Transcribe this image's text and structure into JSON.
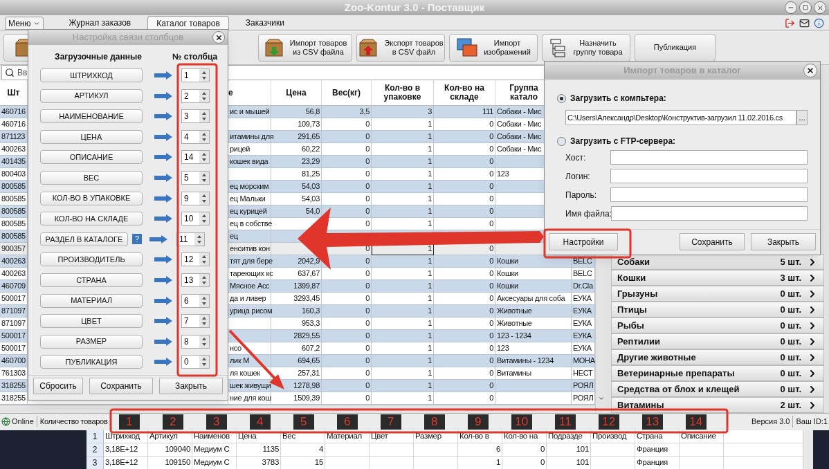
{
  "window": {
    "title": "Zoo-Kontur 3.0 - Поставщик"
  },
  "menu_button": "Меню",
  "tabs": [
    {
      "label": "Журнал заказов",
      "selected": false
    },
    {
      "label": "Каталог товаров",
      "selected": true
    },
    {
      "label": "Заказчики",
      "selected": false
    }
  ],
  "toolbar": [
    {
      "kind": "box"
    },
    {
      "kind": "import",
      "lines": [
        "Импорт товаров",
        "из CSV файла"
      ]
    },
    {
      "kind": "export",
      "lines": [
        "Экспорт товаров",
        "в CSV файл"
      ]
    },
    {
      "kind": "images",
      "lines": [
        "Импорт",
        "изображений"
      ]
    },
    {
      "kind": "group",
      "lines": [
        "Назначить",
        "группу товара"
      ]
    },
    {
      "kind": "plain",
      "lines": [
        "Публикация"
      ]
    }
  ],
  "search": {
    "placeholder": "Вв"
  },
  "table": {
    "columns": [
      "Шт",
      "е",
      "Цена",
      "Вес(кг)",
      "Кол-во в упаковке",
      "Кол-во на складе",
      "Группа катало"
    ],
    "rows": [
      {
        "selected": false,
        "cells": [
          "460716",
          "ис и мышей",
          "56,8",
          "3,5",
          "3",
          "111",
          "Собаки - Мис",
          null
        ]
      },
      {
        "selected": false,
        "cells": [
          "460716",
          null,
          "109,73",
          "0",
          "1",
          "0",
          "Собаки - Мис",
          null
        ]
      },
      {
        "selected": false,
        "cells": [
          "871123",
          "итамины для",
          "291,65",
          "0",
          "1",
          "0",
          "Собаки - Мис",
          null
        ]
      },
      {
        "selected": false,
        "cells": [
          "400263",
          "рицей",
          "60,22",
          "0",
          "1",
          "0",
          "Собаки - Мис",
          null
        ]
      },
      {
        "selected": false,
        "cells": [
          "401435",
          "кошек вида",
          "23,29",
          "0",
          "1",
          "0",
          null,
          null
        ]
      },
      {
        "selected": false,
        "cells": [
          "800403",
          null,
          "81,25",
          "0",
          "1",
          "0",
          "123",
          null
        ]
      },
      {
        "selected": false,
        "cells": [
          "800585",
          "ец морским",
          "54,03",
          "0",
          "1",
          "0",
          null,
          null
        ]
      },
      {
        "selected": false,
        "cells": [
          "800585",
          "ец Мальки",
          "54,03",
          "0",
          "1",
          "0",
          null,
          null
        ]
      },
      {
        "selected": false,
        "cells": [
          "800585",
          "ец курицей",
          "54,0",
          "0",
          "1",
          "0",
          null,
          null
        ]
      },
      {
        "selected": false,
        "cells": [
          "800585",
          "ец в собстве",
          null,
          "0",
          "1",
          "0",
          null,
          null
        ]
      },
      {
        "selected": false,
        "cells": [
          "800585",
          "ец",
          null,
          null,
          null,
          null,
          null,
          null
        ]
      },
      {
        "selected": true,
        "cells": [
          "900357",
          "енситив кон",
          null,
          "0",
          "1",
          "0",
          null,
          null
        ]
      },
      {
        "selected": false,
        "cells": [
          "400263",
          "тят для бере",
          "2042,9",
          "0",
          "1",
          "0",
          "Кошки",
          "BELC"
        ]
      },
      {
        "selected": false,
        "cells": [
          "400263",
          "тареющих кс",
          "637,67",
          "0",
          "1",
          "0",
          "Кошки",
          "BELC"
        ]
      },
      {
        "selected": false,
        "cells": [
          "460709",
          "Мясное Асс",
          "1399,87",
          "0",
          "1",
          "0",
          "Кошки",
          "Dr.Cla"
        ]
      },
      {
        "selected": false,
        "cells": [
          "500017",
          "да и ливер",
          "3293,45",
          "0",
          "1",
          "0",
          "Аксесуары для соба",
          "ЕУКА"
        ]
      },
      {
        "selected": false,
        "cells": [
          "871097",
          "урица рисом",
          "160,3",
          "0",
          "1",
          "0",
          "Животные",
          "ЕУКА"
        ]
      },
      {
        "selected": false,
        "cells": [
          "871097",
          null,
          "953,3",
          "0",
          "1",
          "0",
          "Животные",
          "ЕУКА"
        ]
      },
      {
        "selected": false,
        "cells": [
          "500017",
          null,
          "2829,55",
          "0",
          "1",
          "0",
          "123 - 1234",
          "ЕУКА"
        ]
      },
      {
        "selected": false,
        "cells": [
          "500017",
          "нсо",
          "607,2",
          "0",
          "1",
          "0",
          "123",
          "ЕУКА"
        ]
      },
      {
        "selected": false,
        "cells": [
          "460700",
          "лик М",
          "694,65",
          "0",
          "1",
          "0",
          "Витамины - 1234",
          "МОНА"
        ]
      },
      {
        "selected": false,
        "cells": [
          "761303",
          "ля кошек",
          "257,31",
          "0",
          "1",
          "0",
          "Витамины",
          "НЕСТ"
        ]
      },
      {
        "selected": false,
        "cells": [
          "318255",
          "шек живущи",
          "1278,98",
          "0",
          "1",
          "0",
          null,
          "РОЯЛ"
        ]
      },
      {
        "selected": false,
        "cells": [
          "318255",
          "ние для кош",
          "1509,39",
          "0",
          "1",
          "0",
          null,
          "РОЯЛ"
        ]
      }
    ]
  },
  "column_mapping_dialog": {
    "title": "Настройка связи столбцов",
    "headers": [
      "Загрузочные данные",
      "№ столбца"
    ],
    "rows": [
      {
        "field": "ШТРИХКОД",
        "value": "1"
      },
      {
        "field": "АРТИКУЛ",
        "value": "2"
      },
      {
        "field": "НАИМЕНОВАНИЕ",
        "value": "3"
      },
      {
        "field": "ЦЕНА",
        "value": "4"
      },
      {
        "field": "ОПИСАНИЕ",
        "value": "14"
      },
      {
        "field": "ВЕС",
        "value": "5"
      },
      {
        "field": "КОЛ-ВО В УПАКОВКЕ",
        "value": "9"
      },
      {
        "field": "КОЛ-ВО НА СКЛАДЕ",
        "value": "10"
      },
      {
        "field": "РАЗДЕЛ В КАТАЛОГЕ",
        "value": "11",
        "help": "?"
      },
      {
        "field": "ПРОИЗВОДИТЕЛЬ",
        "value": "12"
      },
      {
        "field": "СТРАНА",
        "value": "13"
      },
      {
        "field": "МАТЕРИАЛ",
        "value": "6"
      },
      {
        "field": "ЦВЕТ",
        "value": "7"
      },
      {
        "field": "РАЗМЕР",
        "value": "8"
      },
      {
        "field": "ПУБЛИКАЦИЯ",
        "value": "0"
      }
    ],
    "buttons": [
      "Сбросить",
      "Сохранить",
      "Закрыть"
    ]
  },
  "import_dialog": {
    "title": "Импорт товаров в каталог",
    "sources": [
      {
        "label": "Загрузить с компьтера:",
        "selected": true
      },
      {
        "label": "Загрузить с FTP-сервера:",
        "selected": false
      }
    ],
    "path": "C:\\Users\\Александр\\Desktop\\Конструктив-загрузил 11.02.2016.cs",
    "browse": "...",
    "fields": [
      "Хост:",
      "Логин:",
      "Пароль:",
      "Имя файла:"
    ],
    "buttons": [
      "Настройки",
      "Сохранить",
      "Закрыть"
    ]
  },
  "categories": [
    {
      "name": "Собаки",
      "count": "5 шт."
    },
    {
      "name": "Кошки",
      "count": "3 шт."
    },
    {
      "name": "Грызуны",
      "count": "0 шт."
    },
    {
      "name": "Птицы",
      "count": "0 шт."
    },
    {
      "name": "Рыбы",
      "count": "0 шт."
    },
    {
      "name": "Рептилии",
      "count": "0 шт."
    },
    {
      "name": "Другие животные",
      "count": "0 шт."
    },
    {
      "name": "Ветеринарные препараты",
      "count": "0 шт."
    },
    {
      "name": "Средства от блох и клещей",
      "count": "0 шт."
    },
    {
      "name": "Витамины",
      "count": "2 шт."
    }
  ],
  "status_bar": {
    "online": "Online",
    "count": "Количество товаров",
    "version": "Версия 3.0",
    "user_id": "Ваш ID:1"
  },
  "markers": [
    "1",
    "2",
    "3",
    "4",
    "5",
    "6",
    "7",
    "8",
    "9",
    "10",
    "11",
    "12",
    "13",
    "14"
  ],
  "spreadsheet": {
    "rows": [
      {
        "number": "1",
        "cells": [
          "Штрихкод",
          "Артикул",
          "Наименов",
          "Цена",
          "Вес",
          "Материал",
          "Цвет",
          "Размер",
          "Кол-во в",
          "Кол-во на",
          "Подразде",
          "Производ",
          "Страна",
          "Описание"
        ]
      },
      {
        "number": "2",
        "cells": [
          "3,18E+12",
          "109040",
          "Медиум С",
          "1135",
          "4",
          null,
          null,
          null,
          "6",
          "0",
          "101",
          null,
          "Франция",
          null
        ]
      },
      {
        "number": "3",
        "cells": [
          "3,18E+12",
          "109150",
          "Медиум С",
          "3783",
          "15",
          null,
          null,
          null,
          "1",
          "0",
          "101",
          null,
          "Франция",
          null
        ]
      }
    ]
  }
}
